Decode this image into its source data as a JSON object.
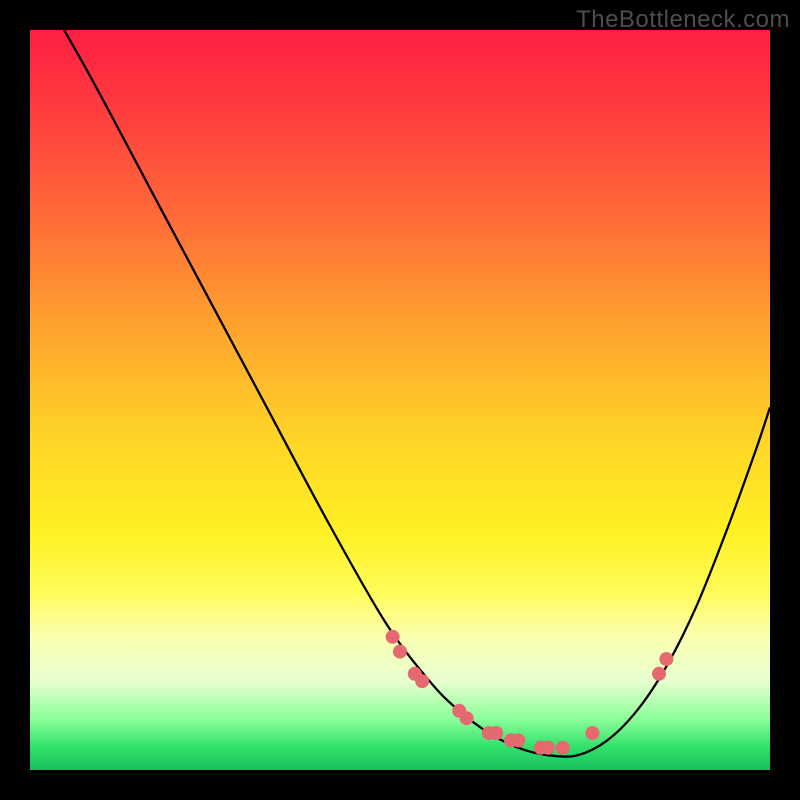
{
  "watermark": "TheBottleneck.com",
  "colors": {
    "frame": "#000000",
    "curve": "#000000",
    "dots": "#e46a6f",
    "gradient_top": "#ff1e43",
    "gradient_bottom": "#18c05a"
  },
  "chart_data": {
    "type": "line",
    "title": "",
    "xlabel": "",
    "ylabel": "",
    "xlim": [
      0,
      100
    ],
    "ylim": [
      0,
      100
    ],
    "curve": {
      "name": "bottleneck-curve",
      "x": [
        0,
        8,
        16,
        24,
        32,
        40,
        48,
        54,
        58,
        62,
        66,
        70,
        74,
        78,
        82,
        86,
        90,
        94,
        98,
        100
      ],
      "values": [
        108,
        94,
        79,
        64,
        49,
        34,
        20,
        12,
        8,
        5,
        3,
        2,
        2,
        4,
        8,
        14,
        22,
        32,
        43,
        49
      ]
    },
    "series": [
      {
        "name": "data-points",
        "x": [
          49,
          50,
          52,
          53,
          58,
          59,
          62,
          63,
          65,
          66,
          69,
          70,
          72,
          76,
          85,
          86
        ],
        "values": [
          18,
          16,
          13,
          12,
          8,
          7,
          5,
          5,
          4,
          4,
          3,
          3,
          3,
          5,
          13,
          15
        ]
      }
    ]
  }
}
